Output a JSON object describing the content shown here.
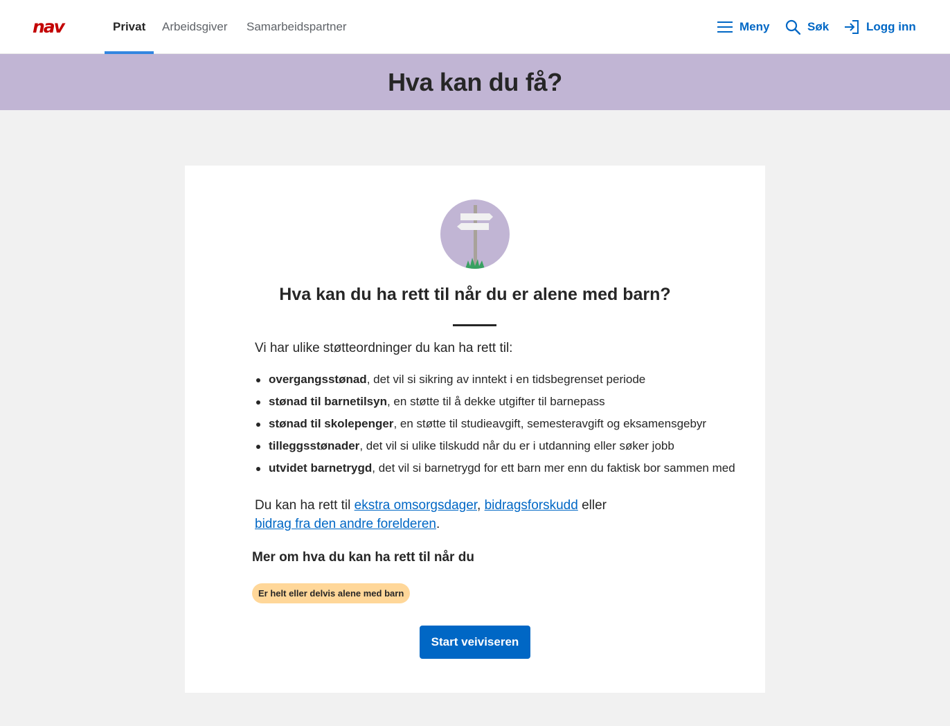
{
  "header": {
    "logo_text": "nav",
    "tabs": [
      {
        "label": "Privat",
        "active": true
      },
      {
        "label": "Arbeidsgiver",
        "active": false
      },
      {
        "label": "Samarbeidspartner",
        "active": false
      }
    ],
    "menu_label": "Meny",
    "search_label": "Søk",
    "login_label": "Logg inn"
  },
  "banner": {
    "title": "Hva kan du få?"
  },
  "card": {
    "heading": "Hva kan du ha rett til når du er alene med barn?",
    "intro": "Vi har ulike støtteordninger du kan ha rett til:",
    "items": [
      {
        "term": "overgangsstønad",
        "desc": ", det vil si sikring av inntekt i en tidsbegrenset periode"
      },
      {
        "term": "stønad til barnetilsyn",
        "desc": ", en støtte til å dekke utgifter til barnepass"
      },
      {
        "term": "stønad til skolepenger",
        "desc": ", en støtte til studieavgift, semesteravgift og eksamensgebyr"
      },
      {
        "term": "tilleggsstønader",
        "desc": ", det vil si ulike tilskudd når du er i utdanning eller søker jobb"
      },
      {
        "term": "utvidet barnetrygd",
        "desc": ", det vil si barnetrygd for ett barn mer enn du faktisk bor sammen med"
      }
    ],
    "paragraph": {
      "prefix": "Du kan ha rett til ",
      "link1": "ekstra omsorgsdager",
      "sep1": ", ",
      "link2": "bidragsforskudd",
      "sep2": " eller ",
      "link3": "bidrag fra den andre forelderen",
      "suffix": "."
    },
    "subheading": "Mer om hva du kan ha rett til når du",
    "tag": "Er helt eller delvis alene med barn",
    "start_button": "Start veiviseren"
  },
  "colors": {
    "brand_red": "#c30000",
    "link_blue": "#0067c5",
    "banner_purple": "#c1b5d4",
    "tag_orange": "#ffd799"
  },
  "icons": [
    "nav-logo",
    "hamburger-icon",
    "search-icon",
    "login-icon",
    "signpost-illustration"
  ]
}
